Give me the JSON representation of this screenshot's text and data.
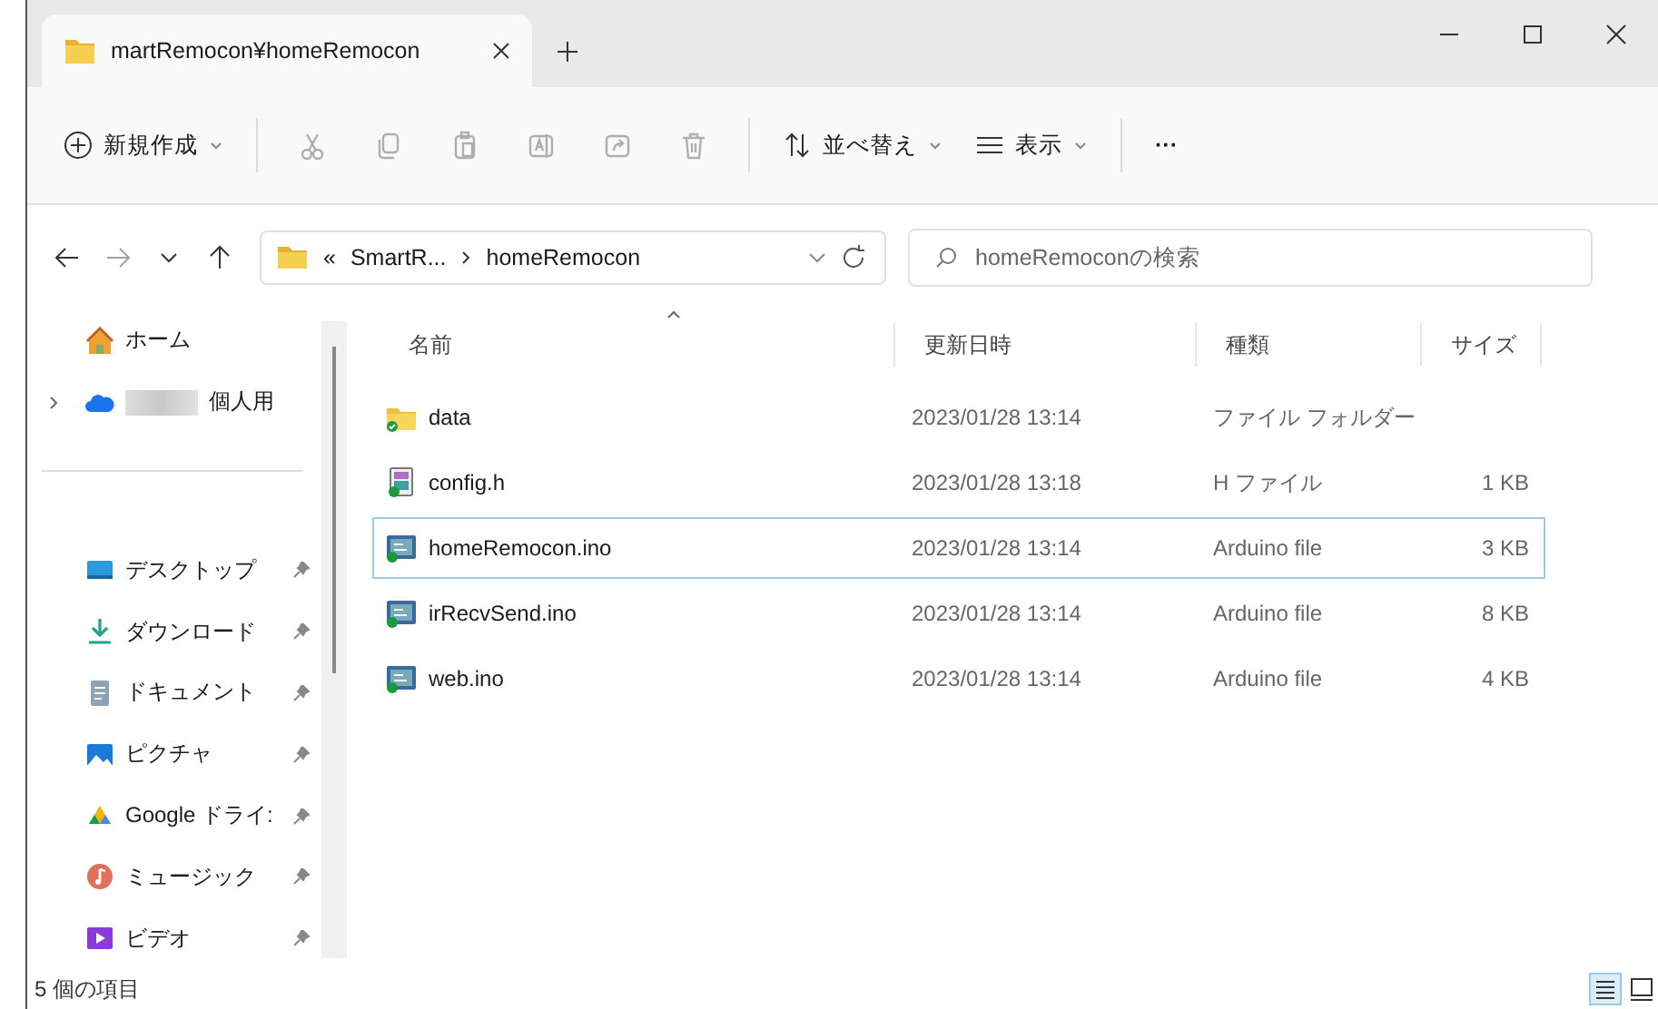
{
  "window": {
    "tab_title": "martRemocon¥homeRemocon"
  },
  "toolbar": {
    "new": {
      "label": "新規作成"
    },
    "actions": [
      {
        "kind": "cut",
        "disabled": true
      },
      {
        "kind": "copy",
        "disabled": true
      },
      {
        "kind": "paste",
        "disabled": true
      },
      {
        "kind": "rename",
        "disabled": true
      },
      {
        "kind": "share",
        "disabled": true
      },
      {
        "kind": "delete",
        "disabled": true
      }
    ],
    "sort": {
      "label": "並べ替え"
    },
    "view": {
      "label": "表示"
    },
    "more": "···"
  },
  "address": {
    "forward_disabled": true,
    "overflow": "«",
    "segments": [
      "SmartR...",
      "homeRemocon"
    ],
    "search": {
      "placeholder": "homeRemoconの検索"
    }
  },
  "sidebar": {
    "items": [
      {
        "kind": "home",
        "label": "ホーム",
        "pinned": false
      },
      {
        "kind": "cloud",
        "label": "個人用",
        "pinned": false,
        "expandable": true
      },
      {
        "kind": "divider"
      },
      {
        "kind": "desktop",
        "label": "デスクトップ",
        "pinned": true
      },
      {
        "kind": "download",
        "label": "ダウンロード",
        "pinned": true
      },
      {
        "kind": "documents",
        "label": "ドキュメント",
        "pinned": true
      },
      {
        "kind": "pictures",
        "label": "ピクチャ",
        "pinned": true
      },
      {
        "kind": "drive",
        "label": "Google ドライ:",
        "pinned": true
      },
      {
        "kind": "music",
        "label": "ミュージック",
        "pinned": true
      },
      {
        "kind": "videos",
        "label": "ビデオ",
        "pinned": true
      }
    ]
  },
  "table": {
    "columns": [
      {
        "label": "名前",
        "sorted": true
      },
      {
        "label": "更新日時",
        "sorted": false
      },
      {
        "label": "種類",
        "sorted": false
      },
      {
        "label": "サイズ",
        "sorted": false
      }
    ],
    "rows": [
      {
        "kind": "folder",
        "name": "data",
        "modified": "2023/01/28 13:14",
        "type": "ファイル フォルダー",
        "focused": false
      },
      {
        "kind": "header",
        "name": "config.h",
        "modified": "2023/01/28 13:18",
        "type": "H ファイル",
        "size": "1 KB",
        "focused": false
      },
      {
        "kind": "sketch",
        "name": "homeRemocon.ino",
        "modified": "2023/01/28 13:14",
        "type": "Arduino file",
        "size": "3 KB",
        "focused": true
      },
      {
        "kind": "sketch",
        "name": "irRecvSend.ino",
        "modified": "2023/01/28 13:14",
        "type": "Arduino file",
        "size": "8 KB",
        "focused": false
      },
      {
        "kind": "sketch",
        "name": "web.ino",
        "modified": "2023/01/28 13:14",
        "type": "Arduino file",
        "size": "4 KB",
        "focused": false
      }
    ]
  },
  "status_bar": {
    "count": "5 個の項目",
    "views": [
      {
        "kind": "details",
        "selected": true
      },
      {
        "kind": "tiles",
        "selected": false
      }
    ]
  }
}
